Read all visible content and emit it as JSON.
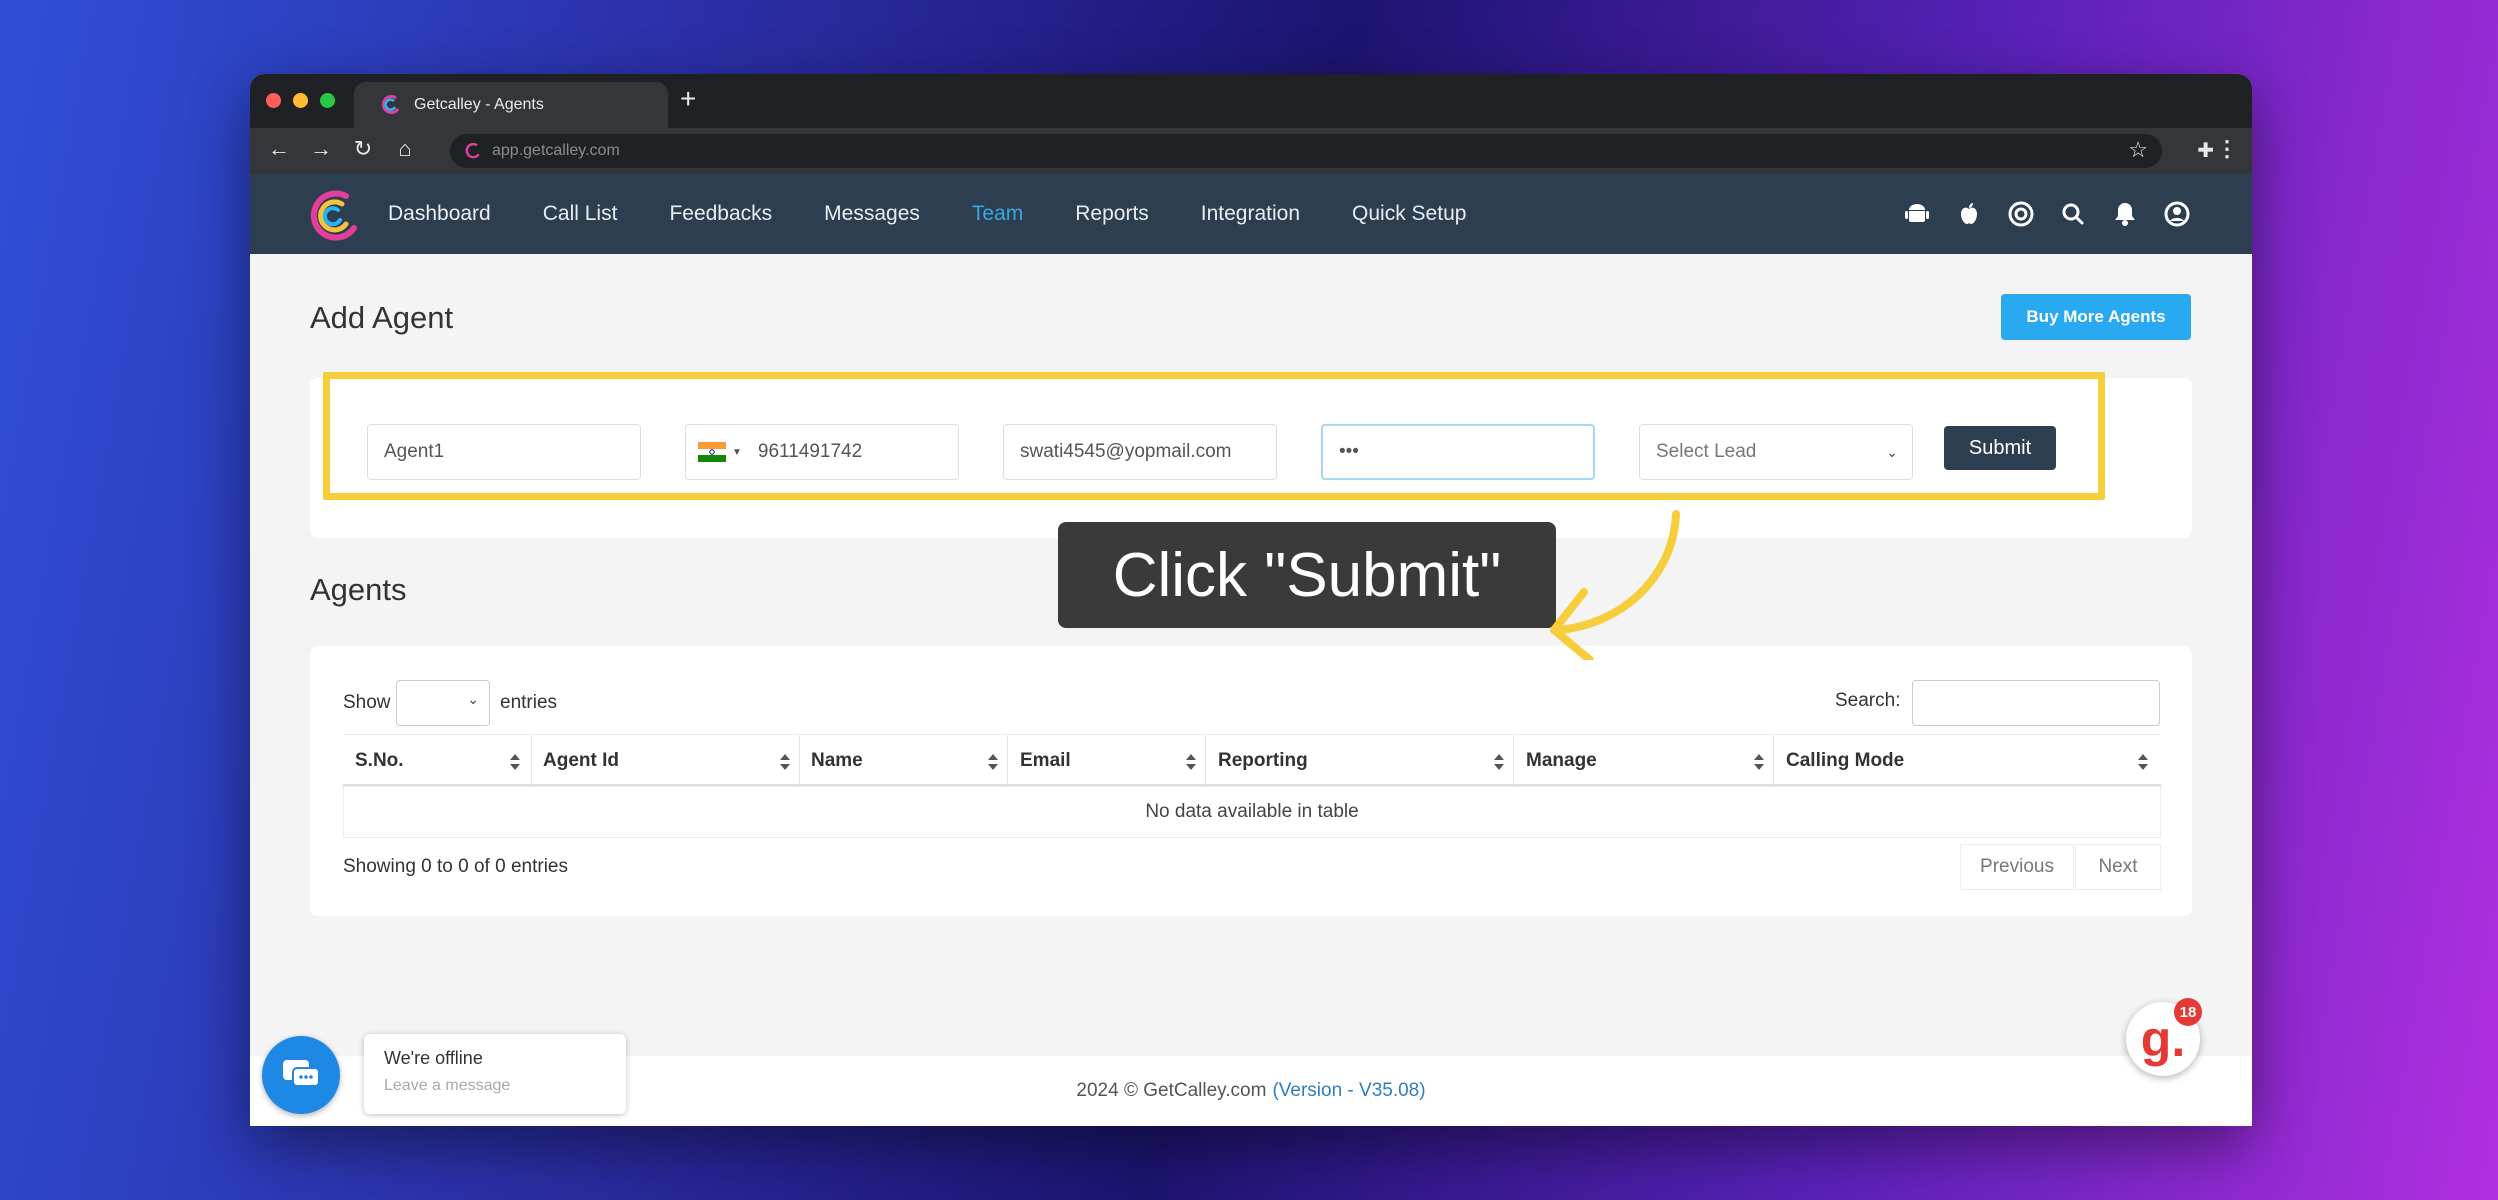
{
  "browser": {
    "tab_title": "Getcalley - Agents",
    "new_tab": "+",
    "url": "app.getcalley.com"
  },
  "nav": {
    "items": [
      "Dashboard",
      "Call List",
      "Feedbacks",
      "Messages",
      "Team",
      "Reports",
      "Integration",
      "Quick Setup"
    ],
    "active": "Team",
    "icons": [
      "android-icon",
      "apple-icon",
      "support-icon",
      "search-icon",
      "bell-icon",
      "user-icon"
    ]
  },
  "add_agent": {
    "title": "Add Agent",
    "buy_more_label": "Buy More Agents",
    "name_value": "Agent1",
    "phone_value": "9611491742",
    "email_value": "swati4545@yopmail.com",
    "password_value": "•••",
    "select_lead_value": "Select Lead",
    "submit_label": "Submit"
  },
  "callout": {
    "text": "Click \"Submit\""
  },
  "agents": {
    "title": "Agents",
    "show_label": "Show",
    "entries_label": "entries",
    "search_label": "Search:",
    "columns": [
      "S.No.",
      "Agent Id",
      "Name",
      "Email",
      "Reporting",
      "Manage",
      "Calling Mode"
    ],
    "empty_text": "No data available in table",
    "info_text": "Showing 0 to 0 of 0 entries",
    "previous_label": "Previous",
    "next_label": "Next"
  },
  "footer": {
    "copyright": "2024 © GetCalley.com",
    "version": "(Version - V35.08)"
  },
  "chat": {
    "title": "We're offline",
    "subtitle": "Leave a message"
  },
  "notification": {
    "letter": "g.",
    "count": "18"
  },
  "colors": {
    "nav_bg": "#2c3e50",
    "active_nav": "#3aa7e0",
    "buy_button": "#29a9f0",
    "highlight": "#f6cd3a",
    "badge_red": "#e53935"
  }
}
